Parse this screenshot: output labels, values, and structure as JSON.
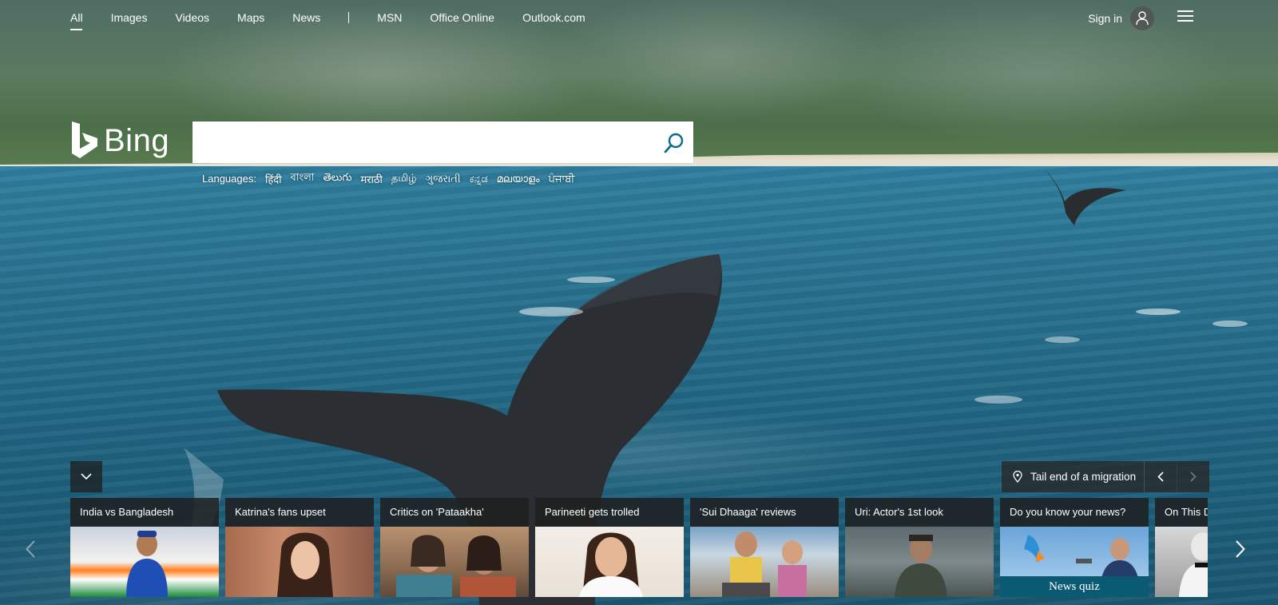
{
  "nav": {
    "items": [
      {
        "label": "All",
        "active": true
      },
      {
        "label": "Images"
      },
      {
        "label": "Videos"
      },
      {
        "label": "Maps"
      },
      {
        "label": "News"
      }
    ],
    "extra_items": [
      {
        "label": "MSN"
      },
      {
        "label": "Office Online"
      },
      {
        "label": "Outlook.com"
      }
    ],
    "signin_label": "Sign in"
  },
  "logo": {
    "text": "Bing"
  },
  "search": {
    "value": "",
    "placeholder": ""
  },
  "languages": {
    "label": "Languages:",
    "items": [
      "हिंदी",
      "বাংলা",
      "తెలుగు",
      "मराठी",
      "தமிழ்",
      "ગુજરાતી",
      "ಕನ್ನಡ",
      "മലയാളം",
      "ਪੰਜਾਬੀ"
    ]
  },
  "image_caption": {
    "text": "Tail end of a migration"
  },
  "news_cards": [
    {
      "title": "India vs Bangladesh"
    },
    {
      "title": "Katrina's fans upset"
    },
    {
      "title": "Critics on 'Pataakha'"
    },
    {
      "title": "Parineeti gets trolled"
    },
    {
      "title": "'Sui Dhaaga' reviews"
    },
    {
      "title": "Uri: Actor's 1st look"
    },
    {
      "title": "Do you know your news?",
      "overlay_label": "News quiz"
    },
    {
      "title": "On This Day"
    }
  ],
  "colors": {
    "quiz_accent": "#0b5a74",
    "card_header_bg": "#1e1e1e"
  },
  "icons": [
    "user-icon",
    "hamburger-menu-icon",
    "bing-logo-icon",
    "search-icon",
    "chevron-down-icon",
    "location-pin-icon",
    "chevron-left-icon",
    "chevron-right-icon"
  ]
}
